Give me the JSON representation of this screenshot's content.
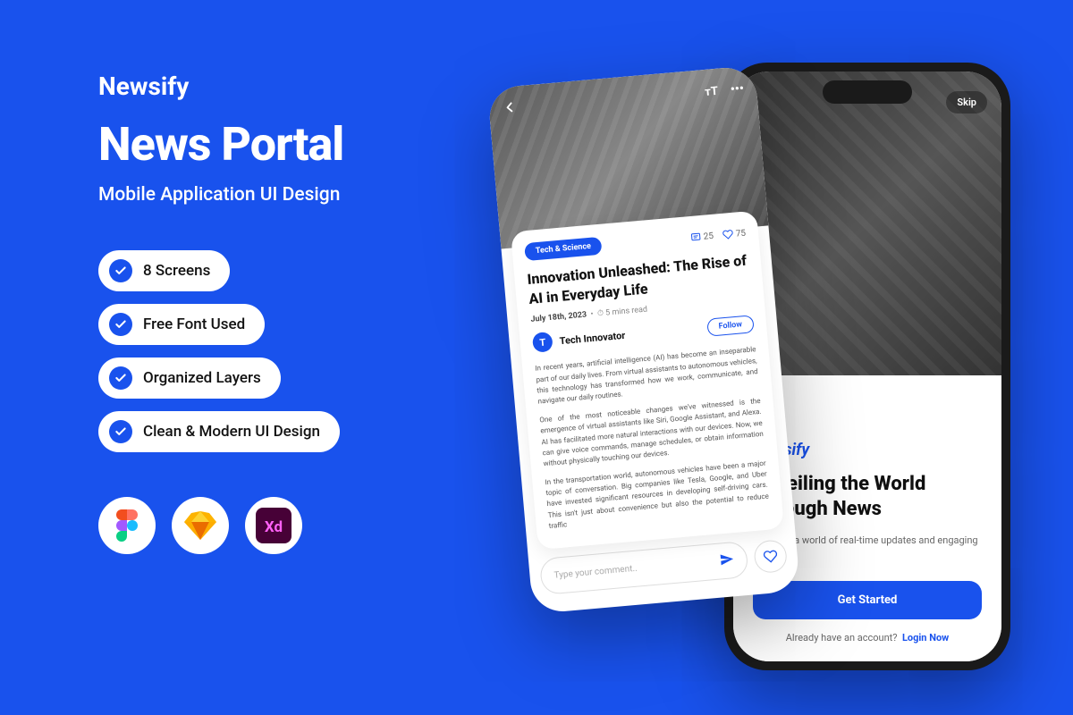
{
  "brand": "Newsify",
  "title": "News Portal",
  "sub": "Mobile Application UI Design",
  "features": [
    "8 Screens",
    "Free Font Used",
    "Organized Layers",
    "Clean & Modern UI Design"
  ],
  "onboard": {
    "skip": "Skip",
    "brand": "Newsify",
    "heading": "Unveiling the World Through News",
    "body": "Step into a world of real-time updates and engaging stories.",
    "cta": "Get Started",
    "loginPrompt": "Already have an account?",
    "loginAction": "Login Now"
  },
  "article": {
    "tag": "Tech & Science",
    "comments": "25",
    "likes": "75",
    "title": "Innovation Unleashed: The Rise of AI in Everyday Life",
    "date": "July 18th, 2023",
    "readtime": "5 mins read",
    "avatar": "T",
    "author": "Tech Innovator",
    "follow": "Follow",
    "p1": "In recent years, artificial intelligence (AI) has become an inseparable part of our daily lives. From virtual assistants to autonomous vehicles, this technology has transformed how we work, communicate, and navigate our daily routines.",
    "p2": "One of the most noticeable changes we've witnessed is the emergence of virtual assistants like Siri, Google Assistant, and Alexa. AI has facilitated more natural interactions with our devices. Now, we can give voice commands, manage schedules, or obtain information without physically touching our devices.",
    "p3": "In the transportation world, autonomous vehicles have been a major topic of conversation. Big companies like Tesla, Google, and Uber have invested significant resources in developing self-driving cars. This isn't just about convenience but also the potential to reduce traffic",
    "placeholder": "Type your comment.."
  }
}
